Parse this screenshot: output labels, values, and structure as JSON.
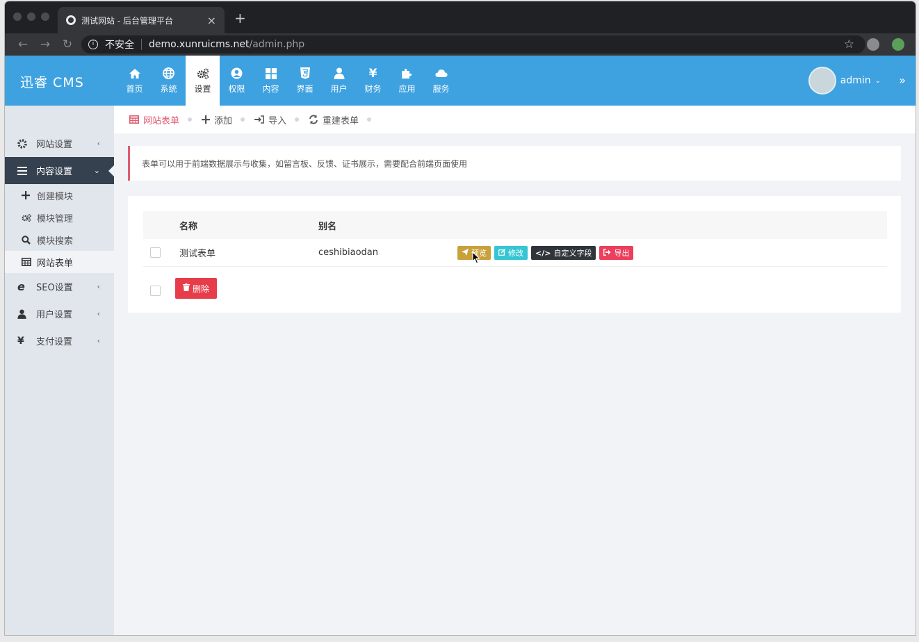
{
  "browser": {
    "tab_title": "测试网站 - 后台管理平台",
    "tab_close": "×",
    "new_tab": "+",
    "security": "不安全",
    "url_host": "demo.xunruicms.net",
    "url_path": "/admin.php"
  },
  "header": {
    "logo": "迅睿 CMS",
    "nav": [
      {
        "label": "首页",
        "icon": "home-icon"
      },
      {
        "label": "系统",
        "icon": "globe-icon"
      },
      {
        "label": "设置",
        "icon": "gears-icon"
      },
      {
        "label": "权限",
        "icon": "user-circle-icon"
      },
      {
        "label": "内容",
        "icon": "windows-icon"
      },
      {
        "label": "界面",
        "icon": "html5-icon"
      },
      {
        "label": "用户",
        "icon": "user-icon"
      },
      {
        "label": "财务",
        "icon": "yen-icon"
      },
      {
        "label": "应用",
        "icon": "puzzle-icon"
      },
      {
        "label": "服务",
        "icon": "cloud-icon"
      }
    ],
    "active_index": 2,
    "user_name": "admin"
  },
  "sidebar": {
    "groups": [
      {
        "label": "网站设置",
        "icon": "cog-icon"
      },
      {
        "label": "内容设置",
        "icon": "bars-icon"
      },
      {
        "label": "SEO设置",
        "icon": "ie-icon"
      },
      {
        "label": "用户设置",
        "icon": "user-icon"
      },
      {
        "label": "支付设置",
        "icon": "yen-icon"
      }
    ],
    "sub": [
      {
        "label": "创建模块",
        "icon": "plus-icon"
      },
      {
        "label": "模块管理",
        "icon": "cogs-icon"
      },
      {
        "label": "模块搜索",
        "icon": "search-icon"
      },
      {
        "label": "网站表单",
        "icon": "table-icon"
      }
    ]
  },
  "toolbar": {
    "items": [
      "网站表单",
      "添加",
      "导入",
      "重建表单"
    ]
  },
  "note": "表单可以用于前端数据展示与收集，如留言板、反馈、证书展示，需要配合前端页面使用",
  "table": {
    "headers": [
      "名称",
      "别名"
    ],
    "rows": [
      {
        "name": "测试表单",
        "alias": "ceshibiaodan"
      }
    ],
    "actions": [
      "预览",
      "修改",
      "自定义字段",
      "导出"
    ],
    "delete_label": "删除"
  },
  "colors": {
    "header_bg": "#3ea1e0",
    "sidebar_active": "#364150",
    "accent_red": "#e05d6f"
  }
}
